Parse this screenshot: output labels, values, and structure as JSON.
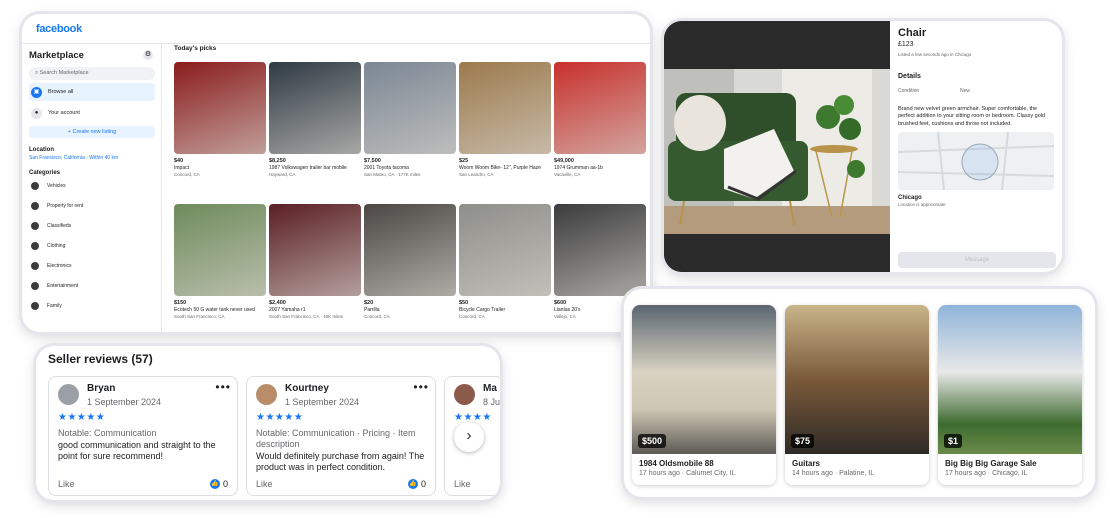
{
  "marketplace": {
    "logo": "facebook",
    "title": "Marketplace",
    "search_placeholder": "Search Marketplace",
    "nav": [
      "Browse all",
      "Your account"
    ],
    "create_label": "+ Create new listing",
    "location_head": "Location",
    "location_value": "San Francisco, California · Within 40 km",
    "categories_head": "Categories",
    "categories": [
      "Vehicles",
      "Property for rent",
      "Classifieds",
      "Clothing",
      "Electronics",
      "Entertainment",
      "Family"
    ],
    "picks_title": "Today's picks",
    "items": [
      {
        "price": "$40",
        "title": "Impact",
        "loc": "Concord, CA",
        "color": "#8a1c1c"
      },
      {
        "price": "$8,250",
        "title": "1987 Volkswagen trailer bar mobile",
        "loc": "Hayward, CA",
        "color": "#2f3a44"
      },
      {
        "price": "$7,500",
        "title": "2001 Toyota tacoma",
        "loc": "San Mateo, CA · 177K miles",
        "color": "#7b8794"
      },
      {
        "price": "$25",
        "title": "Woom Woom Bike- 12\", Purple Haze",
        "loc": "San Leandro, CA",
        "color": "#9c7a4c"
      },
      {
        "price": "$49,000",
        "title": "1974 Grumman aa-1b",
        "loc": "Vacaville, CA",
        "color": "#c8302c"
      },
      {
        "price": "$150",
        "title": "Ecotech 50 G water tank never used",
        "loc": "South San Francisco, CA",
        "color": "#6e8b5b"
      },
      {
        "price": "$2,400",
        "title": "2007 Yamaha r1",
        "loc": "South San Francisco, CA · 40K miles",
        "color": "#5a1e24"
      },
      {
        "price": "$20",
        "title": "Parrilla",
        "loc": "Concord, CA",
        "color": "#4a4744"
      },
      {
        "price": "$50",
        "title": "Bicycle Cargo Trailer",
        "loc": "Concord, CA",
        "color": "#8e8e8a"
      },
      {
        "price": "$600",
        "title": "Llantas 20's",
        "loc": "Vallejo, CA",
        "color": "#3b3b3d"
      }
    ]
  },
  "listing": {
    "title": "Chair",
    "price": "£123",
    "listed": "Listed a few seconds ago in Chicago",
    "details_head": "Details",
    "condition_label": "Condition",
    "condition_value": "New",
    "description": "Brand new velvet green armchair. Super comfortable, the perfect addition to your sitting room or bedroom. Classy gold brushed feet, cushions and throw not included.",
    "city": "Chicago",
    "city_note": "Location is approximate",
    "message_button": "Message"
  },
  "reviews": {
    "title": "Seller reviews (57)",
    "like_label": "Like",
    "items": [
      {
        "name": "Bryan",
        "date": "1 September 2024",
        "stars": "★★★★★",
        "tags": "Notable: Communication",
        "text": "good communication and straight to the point for sure recommend!",
        "count": "0",
        "avatar": "#9aa0a6"
      },
      {
        "name": "Kourtney",
        "date": "1 September 2024",
        "stars": "★★★★★",
        "tags": "Notable: Communication · Pricing · Item description",
        "text": "Would definitely purchase from again! The product was in perfect condition.",
        "count": "0",
        "avatar": "#b98d6a"
      },
      {
        "name": "Ma",
        "date": "8 Ju",
        "stars": "★★★★",
        "tags": "A se",
        "text": "",
        "count": "",
        "avatar": "#8b5a4a"
      }
    ]
  },
  "featured": [
    {
      "price": "$500",
      "title": "1984 Oldsmobile 88",
      "meta": "17 hours ago · Calumet City, IL"
    },
    {
      "price": "$75",
      "title": "Guitars",
      "meta": "14 hours ago · Palatine, IL"
    },
    {
      "price": "$1",
      "title": "Big Big Big Garage Sale",
      "meta": "17 hours ago · Chicago, IL"
    }
  ],
  "colors": {
    "accent": "#1877f2",
    "text": "#1c1e21",
    "muted": "#65676b"
  }
}
